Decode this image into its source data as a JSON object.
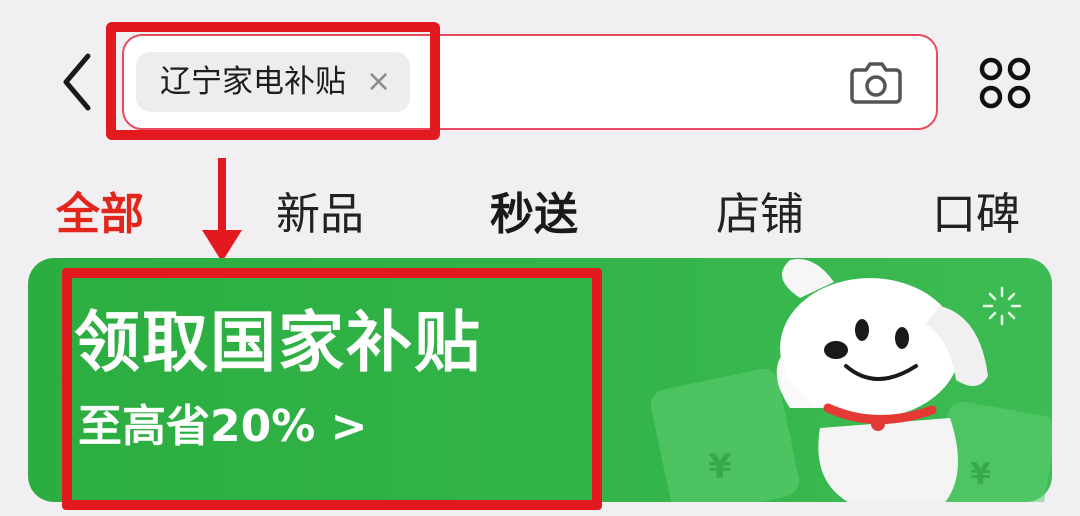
{
  "header": {
    "back_icon": "chevron-left-icon",
    "search_chip": {
      "text": "辽宁家电补贴",
      "close_symbol": "×"
    },
    "camera_icon": "camera-icon",
    "more_icon": "four-circles-grid-icon"
  },
  "tabs": [
    {
      "label": "全部",
      "active": true
    },
    {
      "label": "新品"
    },
    {
      "label": "秒送"
    },
    {
      "label": "店铺"
    },
    {
      "label": "口碑"
    }
  ],
  "banner": {
    "title": "领取国家补贴",
    "subtitle": "至高省20% >",
    "background_color": "#33b449",
    "mascot_icon": "white-dog-mascot-icon",
    "coupon_symbol": "¥"
  },
  "annotations": {
    "color": "#e2191e"
  },
  "colors": {
    "active_tab": "#e3261c",
    "search_border": "#e94a5f"
  }
}
